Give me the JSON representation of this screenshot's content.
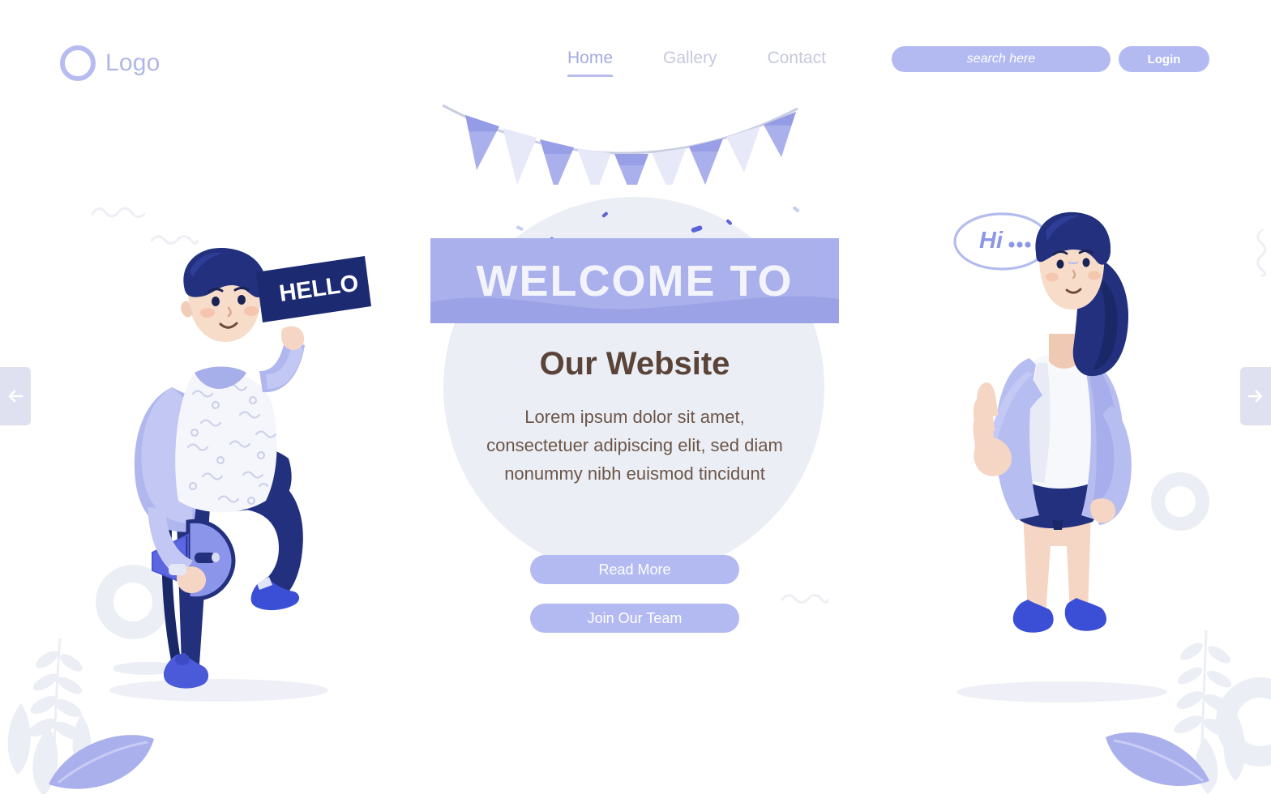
{
  "header": {
    "logo": {
      "text": "Logo",
      "icon": "circle-ring-logo-icon"
    },
    "nav": [
      {
        "label": "Home",
        "active": true
      },
      {
        "label": "Gallery",
        "active": false
      },
      {
        "label": "Contact",
        "active": false
      }
    ],
    "search": {
      "placeholder": "search here",
      "value": ""
    },
    "login_label": "Login"
  },
  "hero": {
    "banner_text": "WELCOME TO",
    "headline": "Our Website",
    "paragraph_line1": "Lorem ipsum dolor sit amet,",
    "paragraph_line2": "consectetuer adipiscing elit, sed diam",
    "paragraph_line3": "nonummy nibh euismod tincidunt",
    "primary_cta": "Read More",
    "secondary_cta": "Join Our Team"
  },
  "illustrations": {
    "left_character": {
      "name": "man-with-megaphone",
      "sign_text": "HELLO"
    },
    "right_character": {
      "name": "woman-waving",
      "speech_bubble_text": "Hi..."
    }
  },
  "carousel": {
    "prev_icon": "arrow-left-icon",
    "next_icon": "arrow-right-icon"
  },
  "colors": {
    "periwinkle": "#b3baf2",
    "banner": "#aab0ec",
    "navy": "#22307e",
    "brown_heading": "#5a4338",
    "brown_body": "#6b5648",
    "pale_gray": "#eceef5",
    "nav_inactive": "#c6c9dd",
    "nav_active": "#a5abdf",
    "arrow_bg": "#dfe1f0",
    "background": "#ffffff"
  }
}
